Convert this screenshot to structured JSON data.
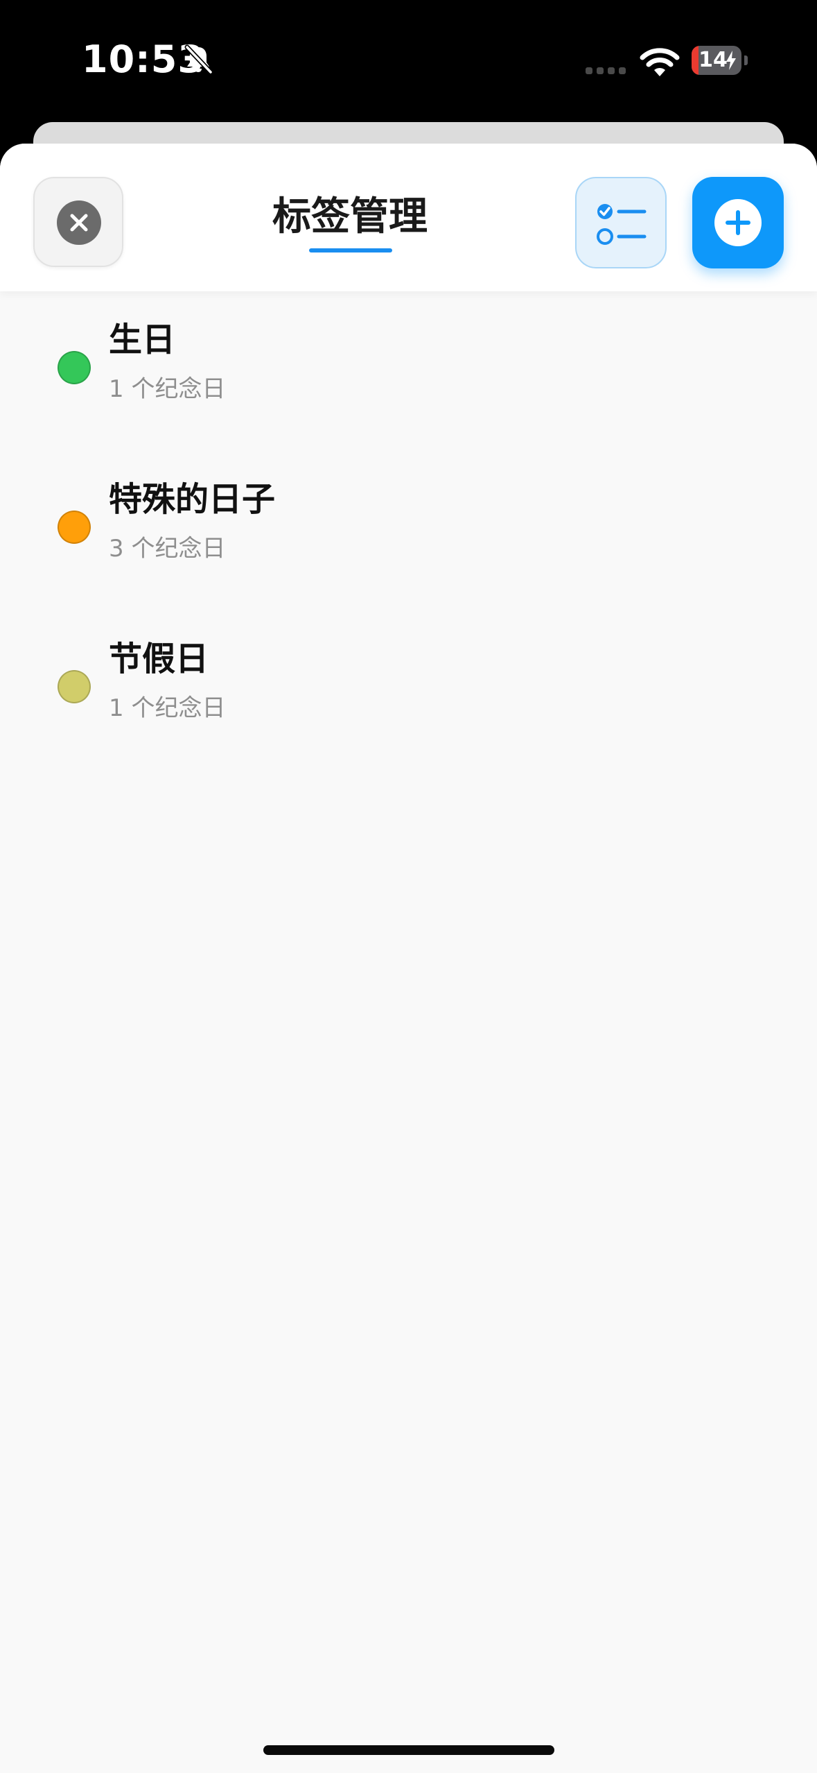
{
  "status_bar": {
    "time": "10:53",
    "battery_level": "14",
    "battery_fraction": 0.14,
    "icons": [
      "bell-slash-icon",
      "cellular-dots-icon",
      "wifi-icon",
      "battery-charging-icon"
    ]
  },
  "header": {
    "title": "标签管理",
    "close_icon": "xmark-circle-icon",
    "select_icon": "checklist-icon",
    "add_icon": "plus-circle-icon"
  },
  "tags": [
    {
      "name": "生日",
      "count_text": "1 个纪念日",
      "color": "#34c759"
    },
    {
      "name": "特殊的日子",
      "count_text": "3 个纪念日",
      "color": "#ff9f0a"
    },
    {
      "name": "节假日",
      "count_text": "1 个纪念日",
      "color": "#d1cd6a"
    }
  ],
  "colors": {
    "accent": "#0e98fa",
    "sheet_background": "#f9f9f9"
  }
}
